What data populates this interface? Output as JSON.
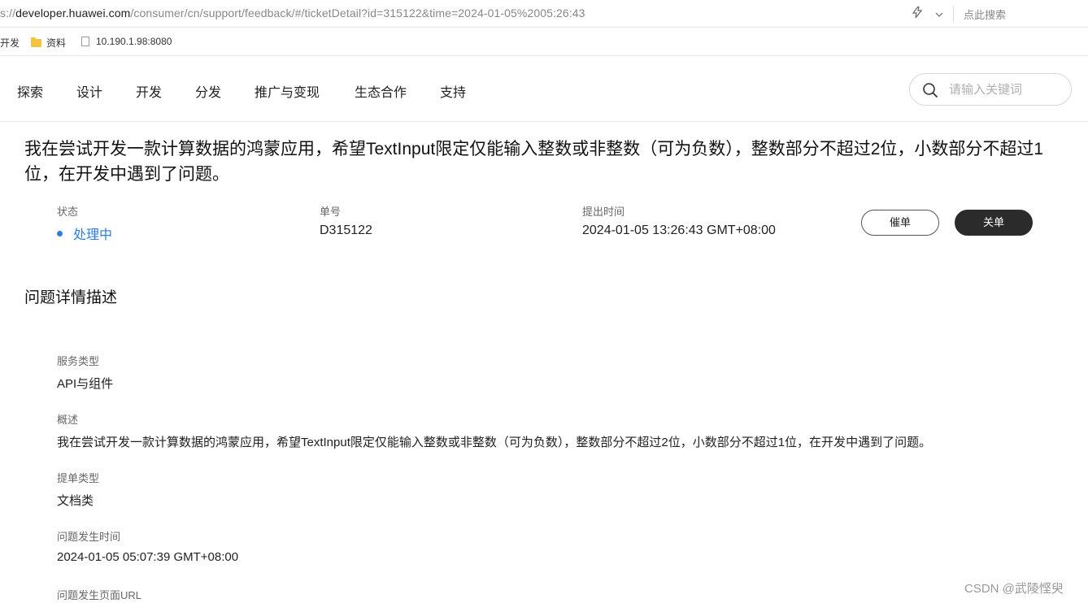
{
  "browser": {
    "url_prefix": "s://",
    "url_host": "developer.huawei.com",
    "url_path": "/consumer/cn/support/feedback/#/ticketDetail?id=315122&time=2024-01-05%2005:26:43",
    "search_placeholder": "点此搜索"
  },
  "bookmarks": [
    {
      "label": "开发"
    },
    {
      "label": "资料"
    },
    {
      "label": "10.190.1.98:8080"
    }
  ],
  "nav": {
    "items": [
      {
        "label": "探索"
      },
      {
        "label": "设计"
      },
      {
        "label": "开发"
      },
      {
        "label": "分发"
      },
      {
        "label": "推广与变现"
      },
      {
        "label": "生态合作"
      },
      {
        "label": "支持"
      }
    ],
    "search_placeholder": "请输入关键词"
  },
  "ticket": {
    "title": "我在尝试开发一款计算数据的鸿蒙应用，希望TextInput限定仅能输入整数或非整数（可为负数），整数部分不超过2位，小数部分不超过1位，在开发中遇到了问题。",
    "status_label": "状态",
    "status_value": "处理中",
    "status_color": "#2e7de1",
    "number_label": "单号",
    "number_value": "D315122",
    "time_label": "提出时间",
    "time_value": "2024-01-05 13:26:43 GMT+08:00",
    "urge_button": "催单",
    "close_button": "关单"
  },
  "details": {
    "section_title": "问题详情描述",
    "fields": [
      {
        "label": "服务类型",
        "value": "API与组件"
      },
      {
        "label": "概述",
        "value": "我在尝试开发一款计算数据的鸿蒙应用，希望TextInput限定仅能输入整数或非整数（可为负数），整数部分不超过2位，小数部分不超过1位，在开发中遇到了问题。"
      },
      {
        "label": "提单类型",
        "value": "文档类"
      },
      {
        "label": "问题发生时间",
        "value": "2024-01-05 05:07:39 GMT+08:00"
      },
      {
        "label": "问题发生页面URL",
        "value": ""
      }
    ]
  },
  "watermark": "CSDN @武陵悭臾"
}
